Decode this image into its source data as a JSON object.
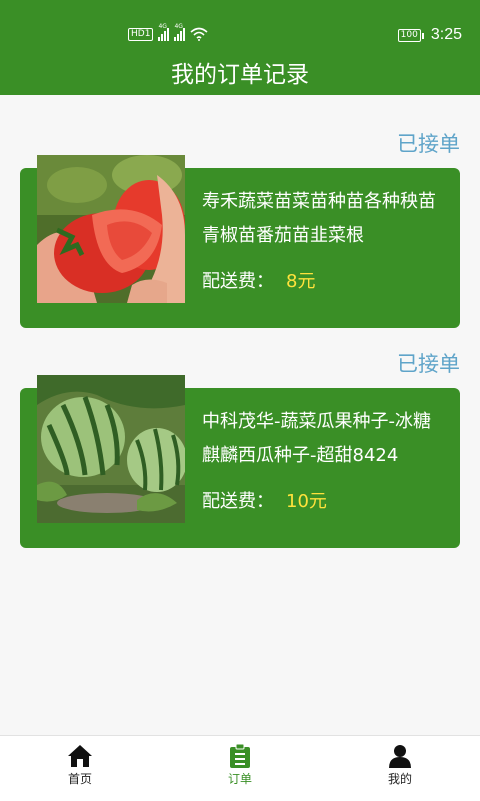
{
  "statusbar": {
    "hd_label": "HD",
    "hd_sub": "1",
    "network_1": "4G",
    "network_2": "4G",
    "battery": "100",
    "time": "3:25"
  },
  "header": {
    "title": "我的订单记录"
  },
  "orders": [
    {
      "status": "已接单",
      "name": "寿禾蔬菜苗菜苗种苗各种秧苗青椒苗番茄苗韭菜根",
      "fee_label": "配送费：",
      "fee_value": "8元",
      "image": "tomato-photo"
    },
    {
      "status": "已接单",
      "name": "中科茂华-蔬菜瓜果种子-冰糖麒麟西瓜种子-超甜8424",
      "fee_label": "配送费：",
      "fee_value": "10元",
      "image": "watermelon-photo"
    }
  ],
  "tabbar": {
    "items": [
      {
        "label": "首页",
        "icon": "home-icon",
        "active": false
      },
      {
        "label": "订单",
        "icon": "clipboard-icon",
        "active": true
      },
      {
        "label": "我的",
        "icon": "person-icon",
        "active": false
      }
    ],
    "active_color": "#3a8f26"
  },
  "colors": {
    "primary_green": "#3a8f26",
    "status_blue": "#5fa4c9",
    "fee_yellow": "#ffe23c"
  }
}
